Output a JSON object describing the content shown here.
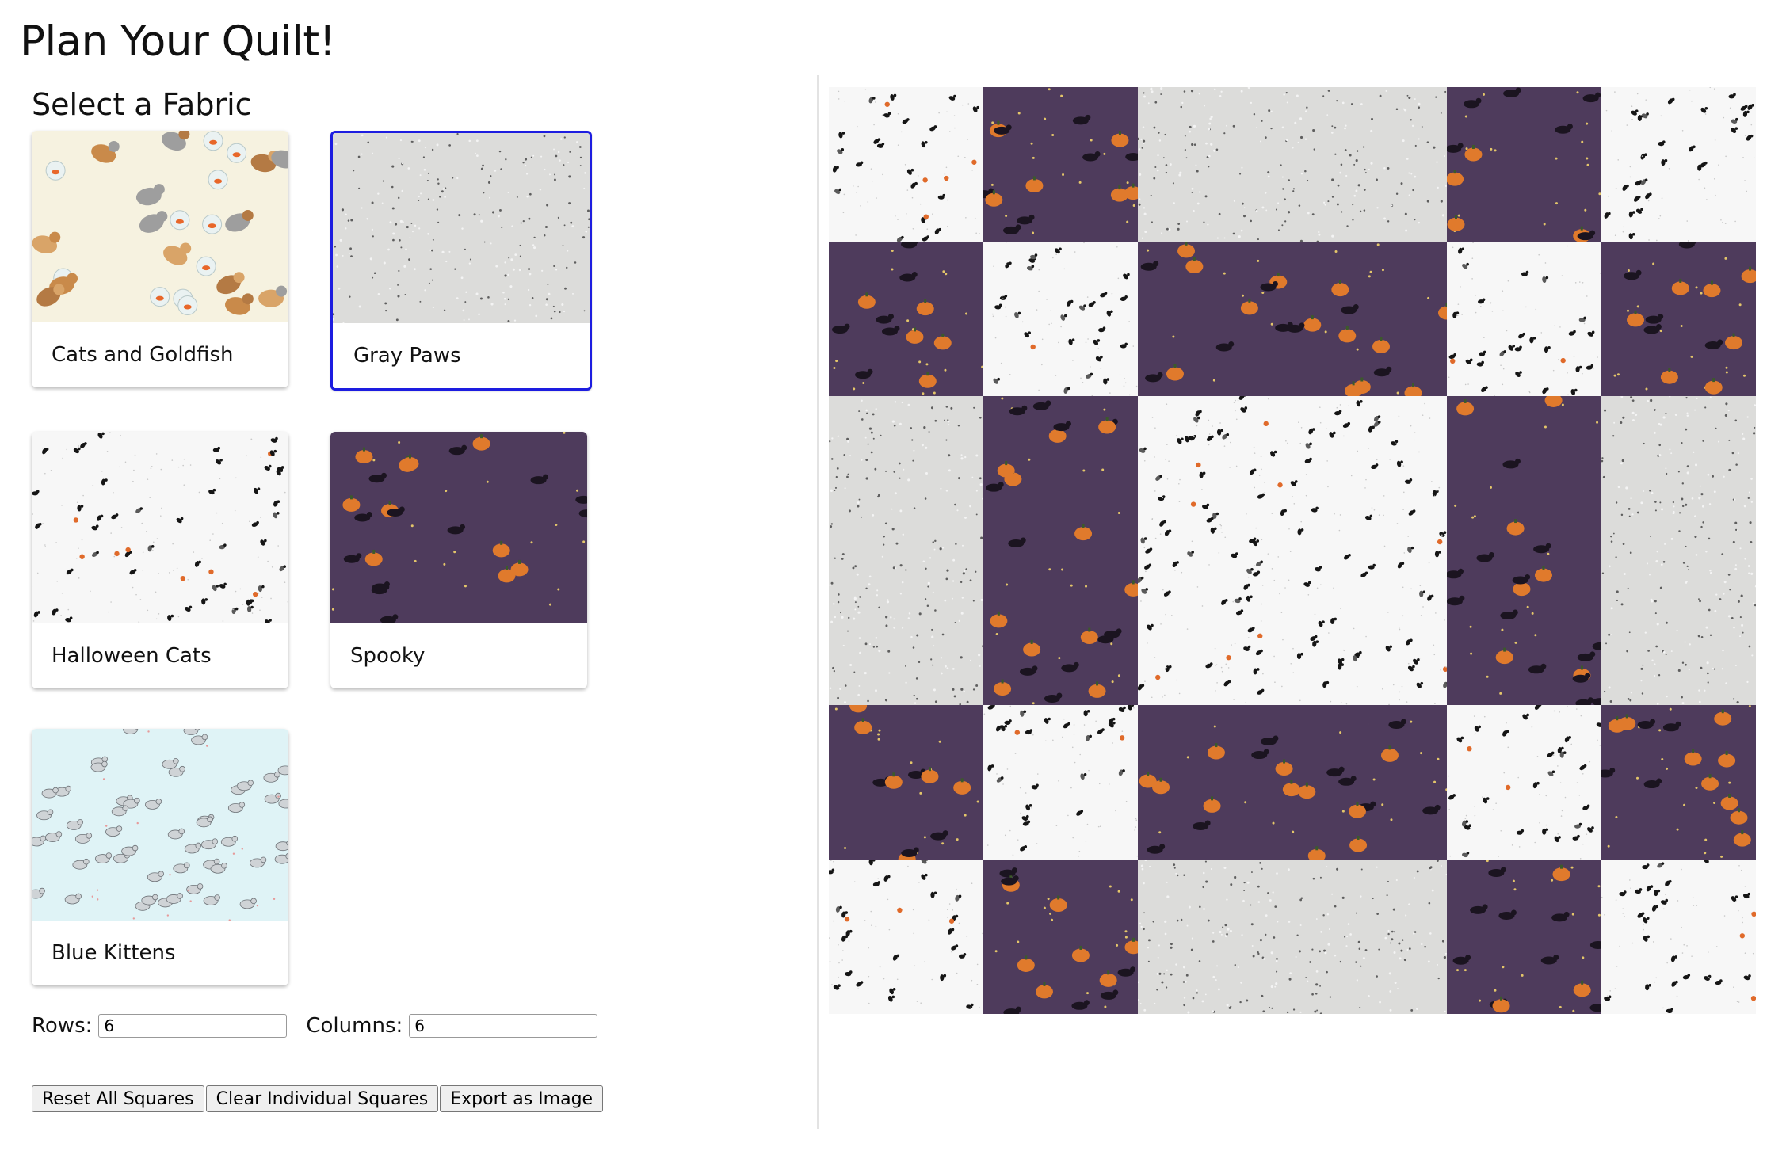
{
  "app": {
    "title": "Plan Your Quilt!"
  },
  "fabric_picker": {
    "heading": "Select a Fabric",
    "fabrics": [
      {
        "id": "cats-goldfish",
        "name": "Cats and Goldfish",
        "selected": false
      },
      {
        "id": "gray-paws",
        "name": "Gray Paws",
        "selected": true
      },
      {
        "id": "halloween-cats",
        "name": "Halloween Cats",
        "selected": false
      },
      {
        "id": "spooky",
        "name": "Spooky",
        "selected": false
      },
      {
        "id": "blue-kittens",
        "name": "Blue Kittens",
        "selected": false
      }
    ]
  },
  "grid_controls": {
    "rows_label": "Rows:",
    "rows_value": "6",
    "columns_label": "Columns:",
    "columns_value": "6"
  },
  "actions": {
    "reset_label": "Reset All Squares",
    "clear_label": "Clear Individual Squares",
    "export_label": "Export as Image"
  },
  "quilt": {
    "squares": [
      [
        "halloween-cats",
        "spooky",
        "gray-paws",
        "spooky",
        "halloween-cats"
      ],
      [
        "spooky",
        "halloween-cats",
        "spooky",
        "halloween-cats",
        "spooky"
      ],
      [
        "gray-paws",
        "spooky",
        "halloween-cats",
        "spooky",
        "gray-paws"
      ],
      [
        "spooky",
        "halloween-cats",
        "spooky",
        "halloween-cats",
        "spooky"
      ],
      [
        "halloween-cats",
        "spooky",
        "gray-paws",
        "spooky",
        "halloween-cats"
      ]
    ]
  },
  "colors": {
    "selected_border": "#1d1de0",
    "spooky_bg": "#4e3b5c",
    "pumpkin": "#e07a2c",
    "gray_paws_bg": "#dcdcda",
    "halloween_bg": "#f7f7f7",
    "blue_kittens_bg": "#dff3f6",
    "cats_goldfish_bg": "#f6f2e0"
  }
}
